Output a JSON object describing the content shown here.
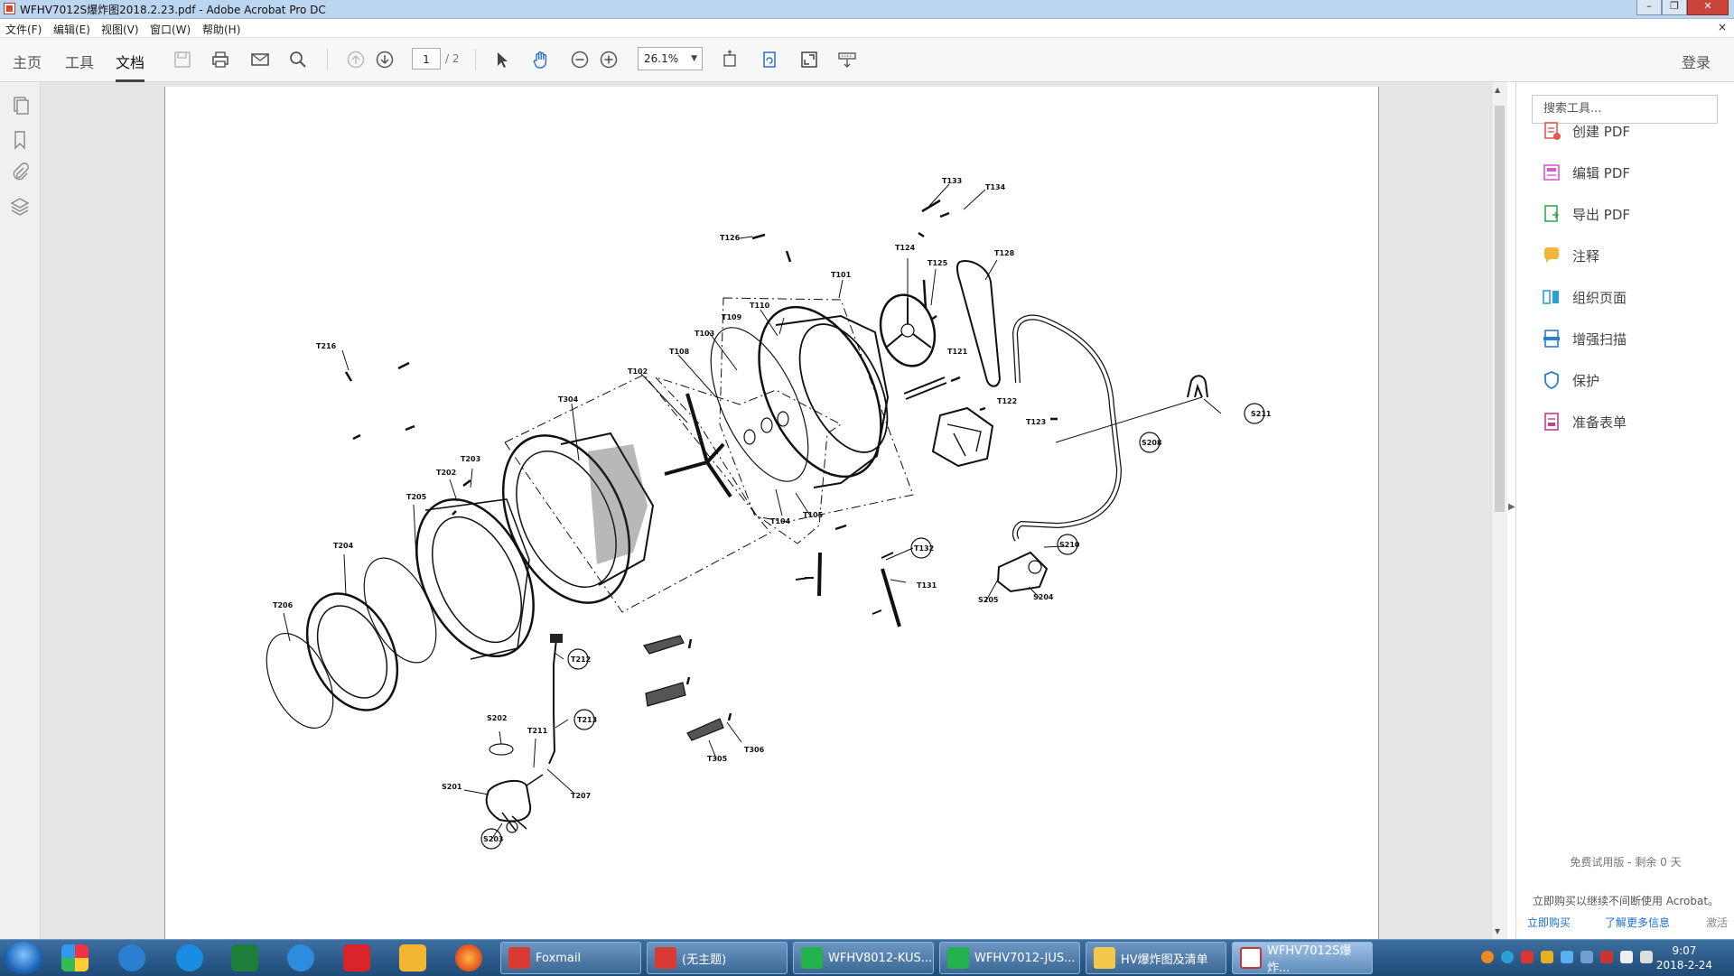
{
  "window": {
    "title": "WFHV7012S爆炸图2018.2.23.pdf - Adobe Acrobat Pro DC"
  },
  "menu": [
    "文件(F)",
    "编辑(E)",
    "视图(V)",
    "窗口(W)",
    "帮助(H)"
  ],
  "menu_close": "×",
  "nav_tabs": [
    "主页",
    "工具",
    "文档"
  ],
  "page_nav": {
    "current": "1",
    "total": "/ 2"
  },
  "zoom": {
    "value": "26.1%"
  },
  "login_label": "登录",
  "right_panel": {
    "search_placeholder": "搜索工具...",
    "tools": [
      {
        "label": "创建 PDF",
        "icon": "create-pdf-icon",
        "color": "#e05a4e"
      },
      {
        "label": "编辑 PDF",
        "icon": "edit-pdf-icon",
        "color": "#d95ad1"
      },
      {
        "label": "导出 PDF",
        "icon": "export-pdf-icon",
        "color": "#3aa655"
      },
      {
        "label": "注释",
        "icon": "comment-icon",
        "color": "#f4b63a"
      },
      {
        "label": "组织页面",
        "icon": "organize-pages-icon",
        "color": "#2aa0d8"
      },
      {
        "label": "增强扫描",
        "icon": "enhance-scan-icon",
        "color": "#2a7fd0"
      },
      {
        "label": "保护",
        "icon": "protect-icon",
        "color": "#2a7fd0"
      },
      {
        "label": "准备表单",
        "icon": "prepare-form-icon",
        "color": "#c13f8f"
      }
    ],
    "trial_text": "免费试用版 - 剩余 0 天",
    "trial_desc": "立即购买以继续不间断使用 Acrobat。",
    "buy_label": "立即购买",
    "learn_label": "了解更多信息",
    "activate_label": "激活"
  },
  "diagram_labels": {
    "t133": "T133",
    "t134": "T134",
    "t128": "T128",
    "t126": "T126",
    "t101": "T101",
    "t124": "T124",
    "t125": "T125",
    "t110": "T110",
    "t109": "T109",
    "t103": "T103",
    "t108": "T108",
    "t102": "T102",
    "t121": "T121",
    "t122": "T122",
    "t123": "T123",
    "t304": "T304",
    "t216": "T216",
    "t203": "T203",
    "t202": "T202",
    "t205": "T205",
    "t204": "T204",
    "t206": "T206",
    "t104": "T104",
    "t105": "T105",
    "t132": "T132",
    "t131": "T131",
    "s211": "S211",
    "s208": "S208",
    "s210": "S210",
    "s205": "S205",
    "s204": "S204",
    "t212": "T212",
    "t213": "T213",
    "s202": "S202",
    "t211": "T211",
    "s201": "S201",
    "t207": "T207",
    "s203": "S203",
    "t306": "T306",
    "t305": "T305"
  },
  "taskbar": {
    "tasks": [
      "Foxmail",
      "(无主题)",
      "WFHV8012-KUS...",
      "WFHV7012-JUS...",
      "HV爆炸图及清单",
      "WFHV7012S爆炸..."
    ],
    "clock_time": "9:07",
    "clock_date": "2018-2-24"
  }
}
